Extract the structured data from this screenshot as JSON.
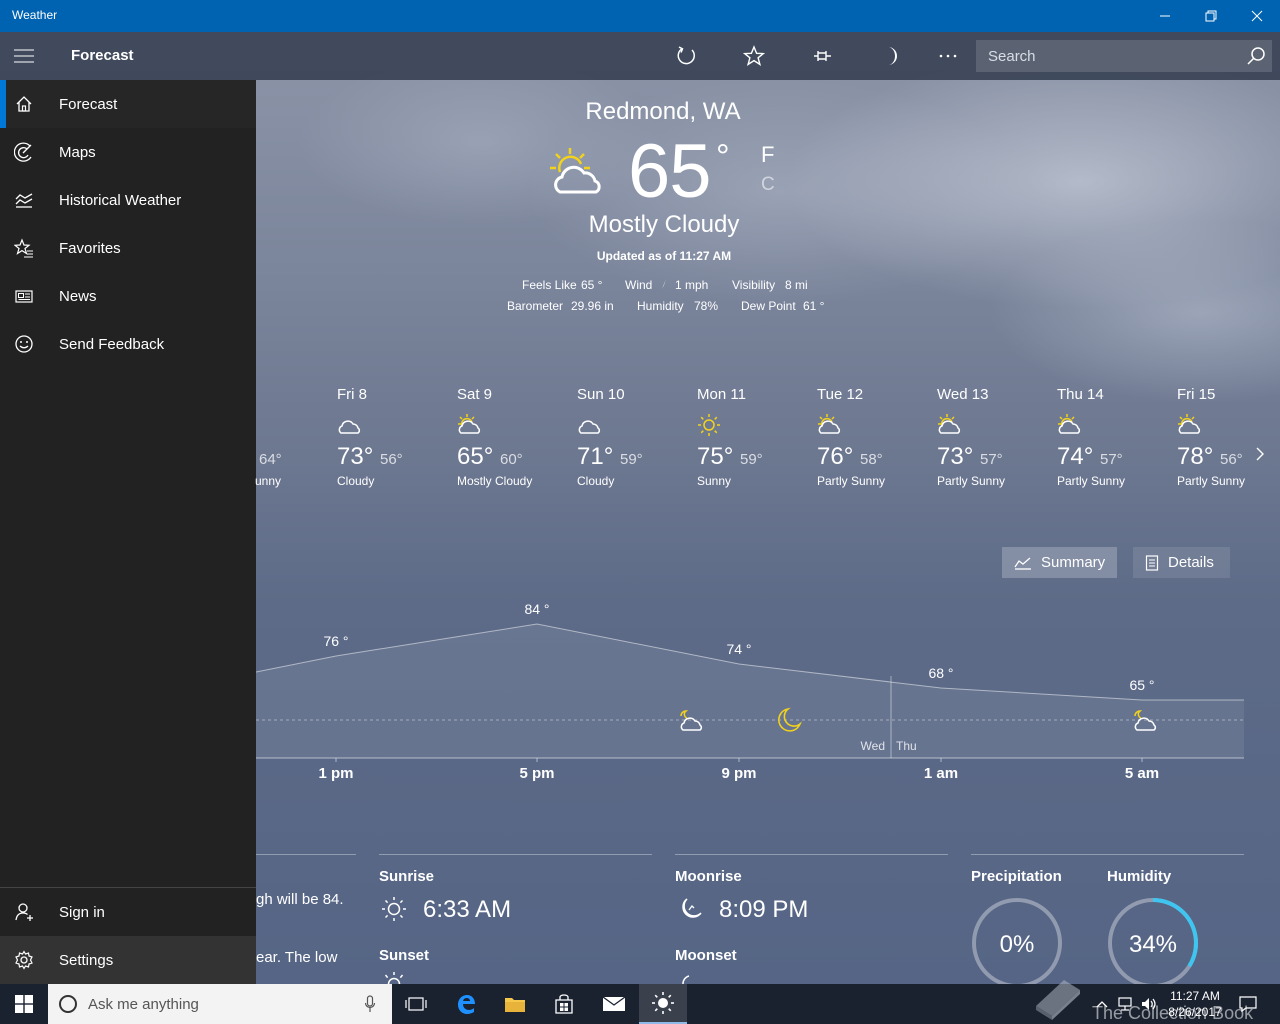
{
  "window": {
    "title": "Weather"
  },
  "appbar": {
    "title": "Forecast",
    "search_placeholder": "Search",
    "icons": [
      "refresh-icon",
      "star-icon",
      "pin-icon",
      "moon-icon",
      "more-icon",
      "search-icon"
    ]
  },
  "sidebar": {
    "items": [
      {
        "label": "Forecast",
        "icon": "home-icon"
      },
      {
        "label": "Maps",
        "icon": "radar-icon"
      },
      {
        "label": "Historical Weather",
        "icon": "chart-icon"
      },
      {
        "label": "Favorites",
        "icon": "favorites-icon"
      },
      {
        "label": "News",
        "icon": "news-icon"
      },
      {
        "label": "Send Feedback",
        "icon": "smiley-icon"
      }
    ],
    "bottom": [
      {
        "label": "Sign in",
        "icon": "person-icon"
      },
      {
        "label": "Settings",
        "icon": "gear-icon"
      }
    ]
  },
  "current": {
    "city": "Redmond, WA",
    "temp": "65",
    "deg": "°",
    "unit_f": "F",
    "unit_c": "C",
    "condition": "Mostly Cloudy",
    "updated": "Updated as of 11:27 AM",
    "feels_like_label": "Feels Like",
    "feels_like": "65 °",
    "wind_label": "Wind",
    "wind": "1 mph",
    "visibility_label": "Visibility",
    "visibility": "8 mi",
    "barometer_label": "Barometer",
    "barometer": "29.96 in",
    "humidity_label": "Humidity",
    "humidity": "78%",
    "dewpoint_label": "Dew Point",
    "dewpoint": "61 °"
  },
  "daily": [
    {
      "day": "",
      "hi": "",
      "lo": "64°",
      "cond": "unny",
      "icon": "none"
    },
    {
      "day": "Fri 8",
      "hi": "73°",
      "lo": "56°",
      "cond": "Cloudy",
      "icon": "cloud-icon"
    },
    {
      "day": "Sat 9",
      "hi": "65°",
      "lo": "60°",
      "cond": "Mostly Cloudy",
      "icon": "partly-cloudy-icon"
    },
    {
      "day": "Sun 10",
      "hi": "71°",
      "lo": "59°",
      "cond": "Cloudy",
      "icon": "cloud-icon"
    },
    {
      "day": "Mon 11",
      "hi": "75°",
      "lo": "59°",
      "cond": "Sunny",
      "icon": "sun-icon"
    },
    {
      "day": "Tue 12",
      "hi": "76°",
      "lo": "58°",
      "cond": "Partly Sunny",
      "icon": "partly-sunny-icon"
    },
    {
      "day": "Wed 13",
      "hi": "73°",
      "lo": "57°",
      "cond": "Partly Sunny",
      "icon": "partly-sunny-icon"
    },
    {
      "day": "Thu 14",
      "hi": "74°",
      "lo": "57°",
      "cond": "Partly Sunny",
      "icon": "partly-sunny-icon"
    },
    {
      "day": "Fri 15",
      "hi": "78°",
      "lo": "56°",
      "cond": "Partly Sunny",
      "icon": "partly-sunny-icon"
    }
  ],
  "view_toggle": {
    "summary": "Summary",
    "details": "Details"
  },
  "chart_data": {
    "type": "area",
    "title": "",
    "xlabel": "",
    "ylabel": "",
    "x_ticks": [
      "1 pm",
      "5 pm",
      "9 pm",
      "1 am",
      "5 am"
    ],
    "temperature_labels": [
      "76 °",
      "84 °",
      "74 °",
      "68 °",
      "65 °"
    ],
    "temperatures": [
      76,
      84,
      74,
      68,
      65
    ],
    "day_divider": [
      "Wed",
      "Thu"
    ],
    "condition_icons": [
      "partly-cloudy-night-icon",
      "moon-icon",
      "partly-cloudy-night-icon"
    ]
  },
  "cards": {
    "summary_line1": "gh will be 84.",
    "summary_line2": "ear. The low",
    "sunrise_label": "Sunrise",
    "sunrise": "6:33 AM",
    "sunset_label": "Sunset",
    "moonrise_label": "Moonrise",
    "moonrise": "8:09 PM",
    "moonset_label": "Moonset",
    "precip_label": "Precipitation",
    "precip": "0%",
    "precip_fraction": 0,
    "humidity_label": "Humidity",
    "humidity": "34%",
    "humidity_fraction": 0.34
  },
  "taskbar": {
    "search_placeholder": "Ask me anything",
    "time": "11:27 AM",
    "date": "8/26/2017",
    "watermark": "The Collection Book"
  },
  "colors": {
    "accent": "#0078d7",
    "titlebar": "#0063b1",
    "sun": "#f2d21b",
    "humidity_ring": "#3fc6f0"
  }
}
